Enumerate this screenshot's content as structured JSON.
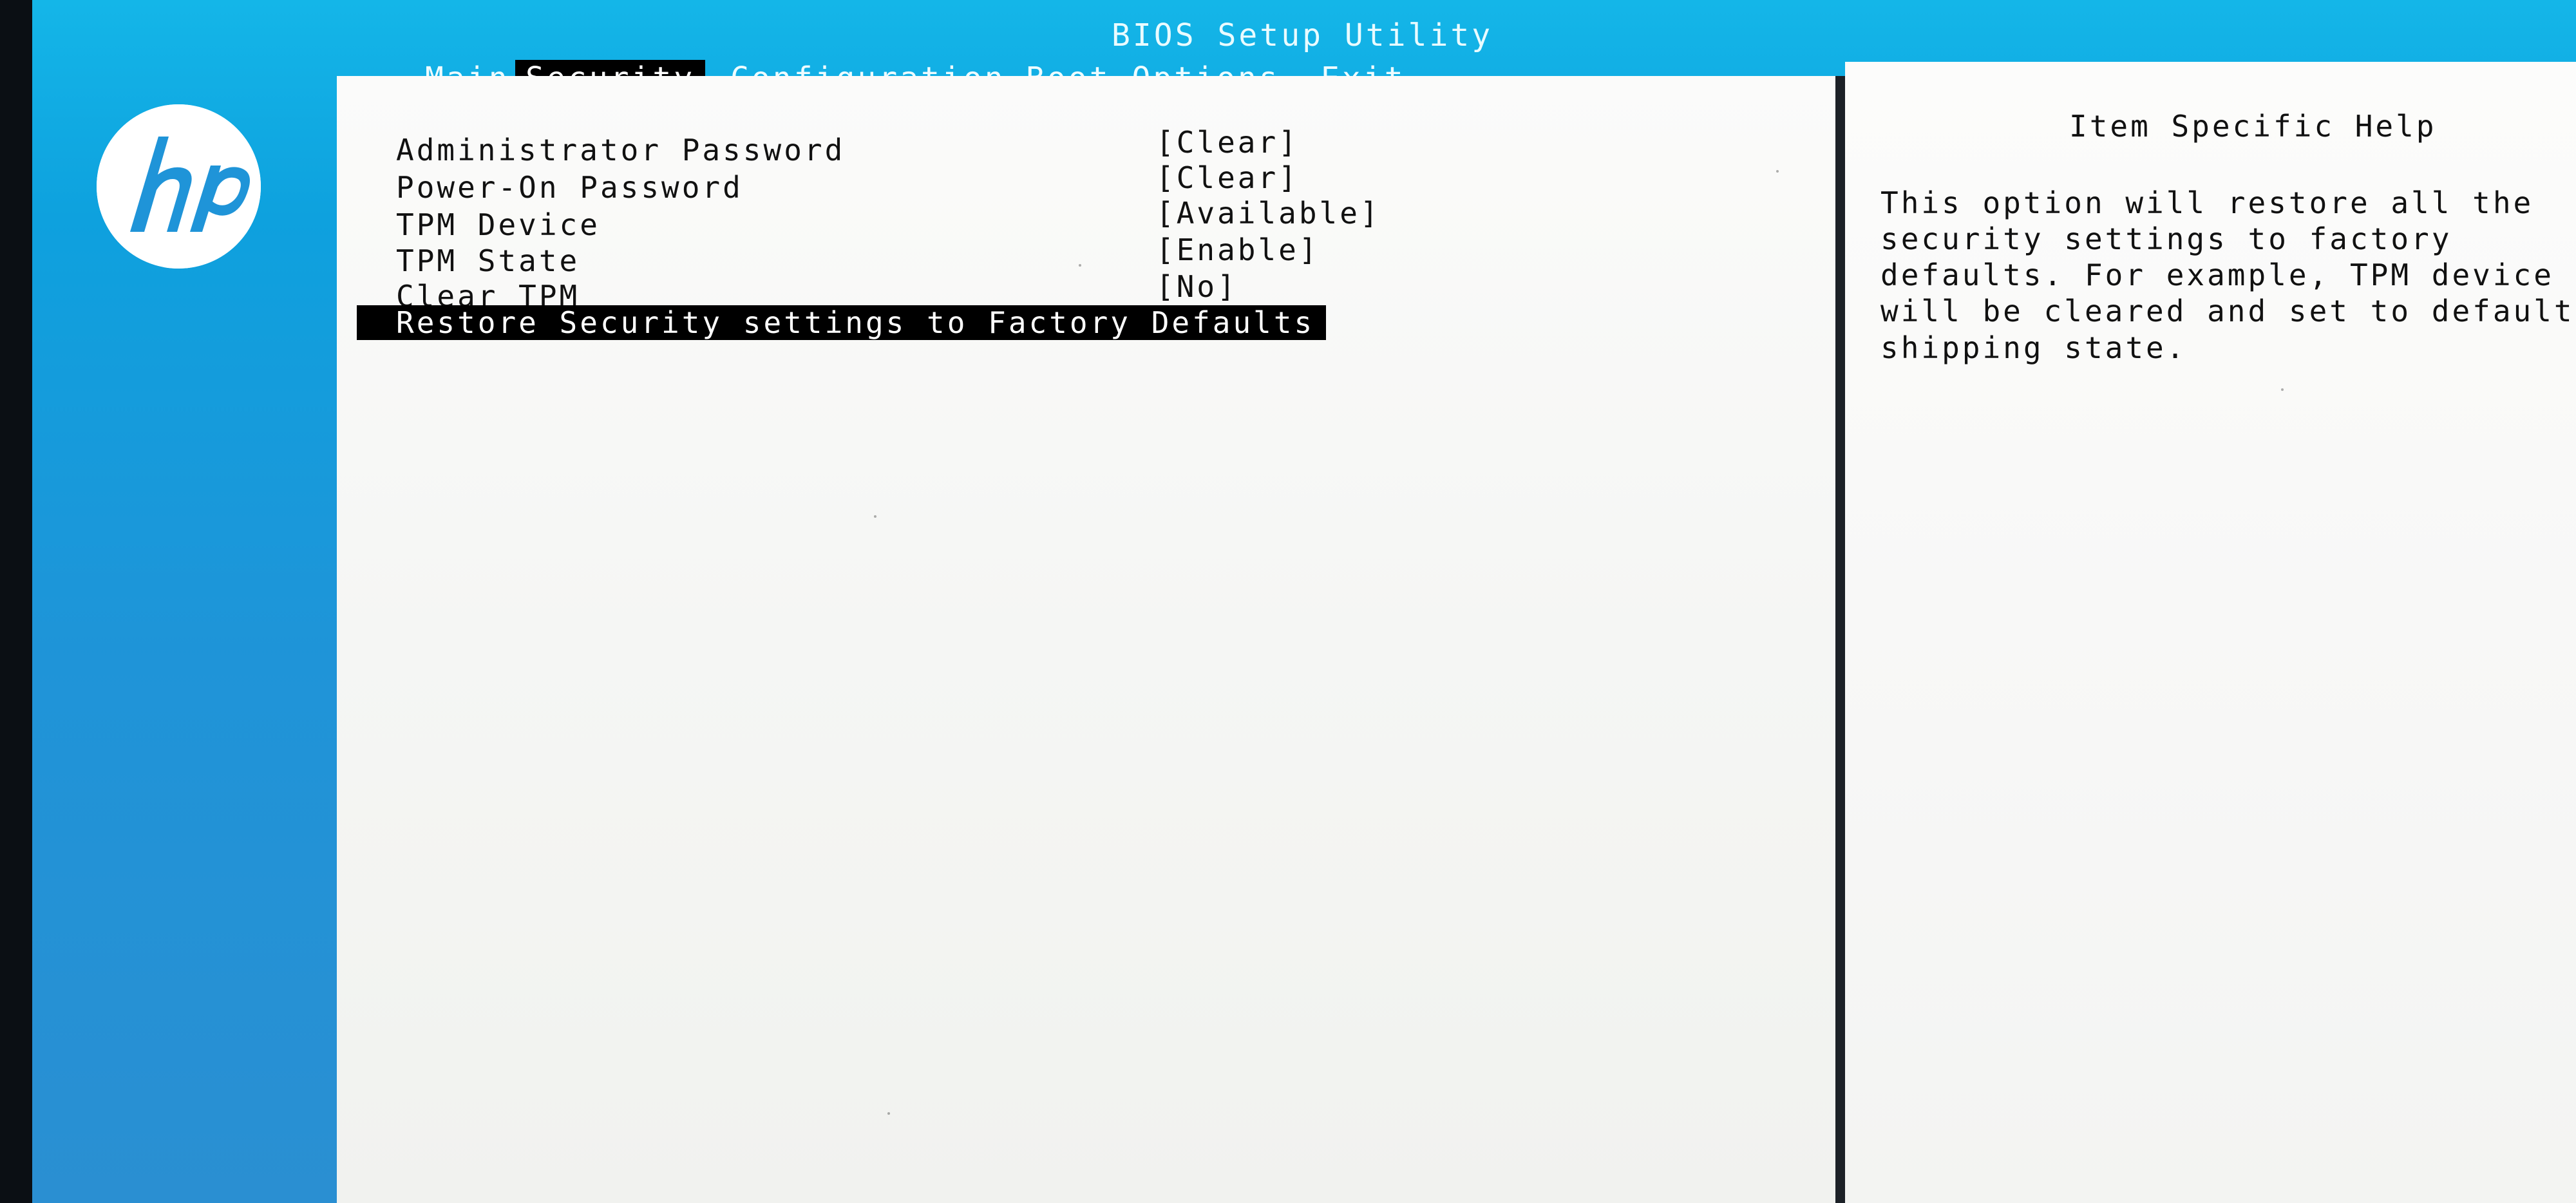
{
  "bios": {
    "title": "BIOS Setup Utility"
  },
  "brand": {
    "logo": "hp-logo",
    "accent_color": "#1f94d8"
  },
  "menu": {
    "tabs": [
      {
        "label": "Main"
      },
      {
        "label": "Security",
        "active": true
      },
      {
        "label": "Configuration"
      },
      {
        "label": "Boot Options"
      },
      {
        "label": "Exit"
      }
    ]
  },
  "security": {
    "items": [
      {
        "label": "Administrator Password",
        "value": "[Clear]"
      },
      {
        "label": "Power-On Password",
        "value": "[Clear]"
      },
      {
        "label": "TPM Device",
        "value": "[Available]"
      },
      {
        "label": "TPM State",
        "value": "[Enable]"
      },
      {
        "label": "Clear TPM",
        "value": "[No]"
      },
      {
        "label": "Restore Security settings to Factory Defaults",
        "value": "",
        "selected": true
      }
    ]
  },
  "help": {
    "title": "Item Specific Help",
    "lines": [
      "This option will restore all the",
      "security settings to factory",
      "defaults. For example, TPM device",
      "will be cleared and set to default",
      "shipping state."
    ]
  }
}
